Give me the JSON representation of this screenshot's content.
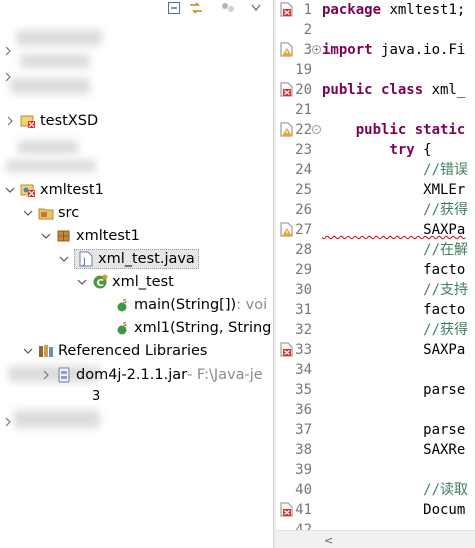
{
  "explorer": {
    "toolbar": {
      "icons": [
        "collapse-all-icon",
        "link-with-editor-icon",
        "view-menu-icon",
        "chevron-down-icon"
      ]
    },
    "projects": [
      {
        "label": "testXSD"
      },
      {
        "label": "xmltest1"
      }
    ],
    "src_label": "src",
    "package_label": "xmltest1",
    "file_label": "xml_test.java",
    "class_label": "xml_test",
    "methods": [
      {
        "name": "main(String[])",
        "suffix": " : voi"
      },
      {
        "name": "xml1(String, String"
      }
    ],
    "ref_libs_label": "Referenced Libraries",
    "jar": {
      "name": "dom4j-2.1.1.jar",
      "path": " - F:\\Java-je"
    },
    "partial_label": "3"
  },
  "editor": {
    "lines": [
      {
        "n": "1",
        "marker": "error",
        "fold": "",
        "tokens": [
          {
            "t": "package ",
            "c": "kw"
          },
          {
            "t": "xmltest1;",
            "c": ""
          }
        ]
      },
      {
        "n": "2",
        "marker": "",
        "fold": "",
        "tokens": []
      },
      {
        "n": "3",
        "marker": "warning",
        "fold": "+",
        "tokens": [
          {
            "t": "import ",
            "c": "kw"
          },
          {
            "t": "java.io.Fi",
            "c": ""
          }
        ]
      },
      {
        "n": "19",
        "marker": "",
        "fold": "",
        "tokens": []
      },
      {
        "n": "20",
        "marker": "error",
        "fold": "",
        "tokens": [
          {
            "t": "public class ",
            "c": "kw"
          },
          {
            "t": "xml_",
            "c": ""
          }
        ]
      },
      {
        "n": "21",
        "marker": "",
        "fold": "",
        "tokens": []
      },
      {
        "n": "22",
        "marker": "warning",
        "fold": "-",
        "tokens": [
          {
            "t": "    public static",
            "c": "kw"
          }
        ]
      },
      {
        "n": "23",
        "marker": "",
        "fold": "",
        "tokens": [
          {
            "t": "        ",
            "c": ""
          },
          {
            "t": "try",
            "c": "kw"
          },
          {
            "t": " {",
            "c": ""
          }
        ]
      },
      {
        "n": "24",
        "marker": "",
        "fold": "",
        "tokens": [
          {
            "t": "            //错误",
            "c": "cm"
          }
        ]
      },
      {
        "n": "25",
        "marker": "",
        "fold": "",
        "tokens": [
          {
            "t": "            XMLEr",
            "c": ""
          }
        ]
      },
      {
        "n": "26",
        "marker": "",
        "fold": "",
        "tokens": [
          {
            "t": "            //获得",
            "c": "cm"
          }
        ]
      },
      {
        "n": "27",
        "marker": "warning",
        "fold": "",
        "tokens": [
          {
            "t": "            SAXPa",
            "c": "squig"
          }
        ]
      },
      {
        "n": "28",
        "marker": "",
        "fold": "",
        "tokens": [
          {
            "t": "            //在解",
            "c": "cm"
          }
        ]
      },
      {
        "n": "29",
        "marker": "",
        "fold": "",
        "tokens": [
          {
            "t": "            facto",
            "c": ""
          }
        ]
      },
      {
        "n": "30",
        "marker": "",
        "fold": "",
        "tokens": [
          {
            "t": "            //支持",
            "c": "cm"
          }
        ]
      },
      {
        "n": "31",
        "marker": "",
        "fold": "",
        "tokens": [
          {
            "t": "            facto",
            "c": ""
          }
        ]
      },
      {
        "n": "32",
        "marker": "",
        "fold": "",
        "tokens": [
          {
            "t": "            //获得",
            "c": "cm"
          }
        ]
      },
      {
        "n": "33",
        "marker": "error",
        "fold": "",
        "tokens": [
          {
            "t": "            SAXPa",
            "c": ""
          }
        ]
      },
      {
        "n": "34",
        "marker": "",
        "fold": "",
        "tokens": []
      },
      {
        "n": "35",
        "marker": "",
        "fold": "",
        "tokens": [
          {
            "t": "            parse",
            "c": ""
          }
        ]
      },
      {
        "n": "36",
        "marker": "",
        "fold": "",
        "tokens": []
      },
      {
        "n": "37",
        "marker": "",
        "fold": "",
        "tokens": [
          {
            "t": "            parse",
            "c": ""
          }
        ]
      },
      {
        "n": "38",
        "marker": "",
        "fold": "",
        "tokens": [
          {
            "t": "            SAXRe",
            "c": ""
          }
        ]
      },
      {
        "n": "39",
        "marker": "",
        "fold": "",
        "tokens": []
      },
      {
        "n": "40",
        "marker": "",
        "fold": "",
        "tokens": [
          {
            "t": "            //读取",
            "c": "cm"
          }
        ]
      },
      {
        "n": "41",
        "marker": "error",
        "fold": "",
        "tokens": [
          {
            "t": "            Docum",
            "c": ""
          }
        ]
      },
      {
        "n": "42",
        "marker": "",
        "fold": "",
        "tokens": []
      }
    ],
    "scroll_left_arrow": "<"
  },
  "colors": {
    "keyword": "#7f0055",
    "comment": "#3f7f5f",
    "line_number": "#787878",
    "error": "#d9302c",
    "warning": "#e8a92b"
  }
}
